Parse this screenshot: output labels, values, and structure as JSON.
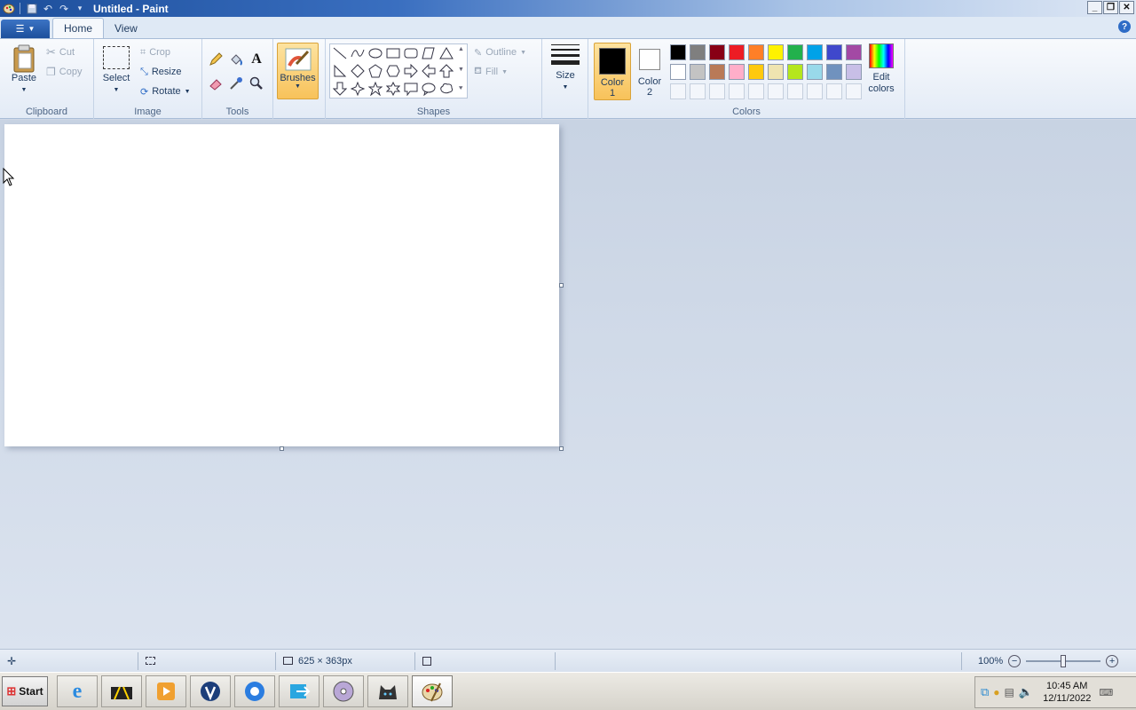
{
  "window": {
    "title": "Untitled - Paint"
  },
  "tabs": {
    "file_icon": "paint-menu-icon",
    "home": "Home",
    "view": "View"
  },
  "ribbon": {
    "clipboard": {
      "label": "Clipboard",
      "paste": "Paste",
      "cut": "Cut",
      "copy": "Copy"
    },
    "image": {
      "label": "Image",
      "select": "Select",
      "crop": "Crop",
      "resize": "Resize",
      "rotate": "Rotate"
    },
    "tools": {
      "label": "Tools"
    },
    "brushes": {
      "label": "Brushes"
    },
    "shapes": {
      "label": "Shapes",
      "outline": "Outline",
      "fill": "Fill"
    },
    "size": {
      "label": "Size"
    },
    "colors": {
      "label": "Colors",
      "color1_label": "Color",
      "color1_num": "1",
      "color2_label": "Color",
      "color2_num": "2",
      "edit_label": "Edit",
      "edit_label2": "colors",
      "color1": "#000000",
      "color2": "#ffffff",
      "row1": [
        "#000000",
        "#7f7f7f",
        "#880015",
        "#ed1c24",
        "#ff7f27",
        "#fff200",
        "#22b14c",
        "#00a2e8",
        "#3f48cc",
        "#a349a4"
      ],
      "row2": [
        "#ffffff",
        "#c3c3c3",
        "#b97a57",
        "#ffaec9",
        "#ffc90e",
        "#efe4b0",
        "#b5e61d",
        "#99d9ea",
        "#7092be",
        "#c8bfe7"
      ]
    }
  },
  "status": {
    "image_size": "625 × 363px",
    "zoom": "100%"
  },
  "taskbar": {
    "start": "Start",
    "time": "10:45 AM",
    "date": "12/11/2022"
  }
}
